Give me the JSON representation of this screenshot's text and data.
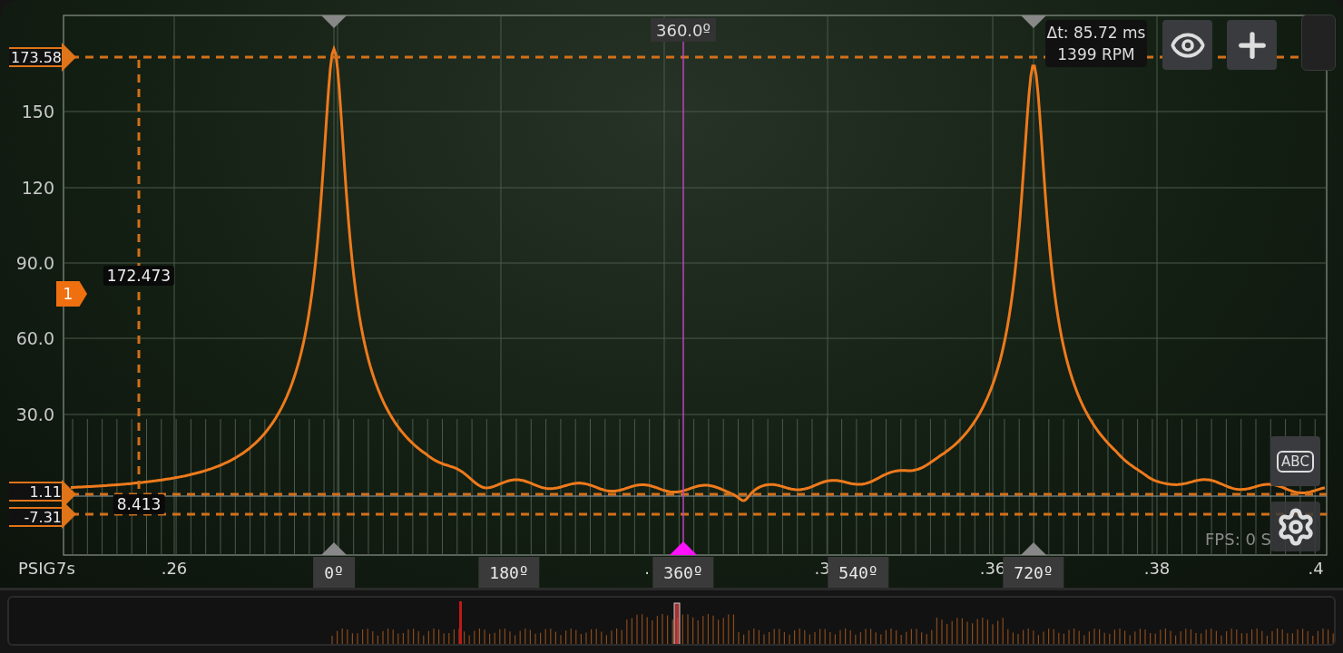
{
  "y_axis": {
    "unit": "PSIG",
    "ticks": [
      "150",
      "120",
      "90.0",
      "60.0",
      "30.0"
    ]
  },
  "x_axis": {
    "unit": "7s",
    "ticks": [
      ".26",
      ".",
      ".3",
      ".36",
      ".38",
      ".4"
    ]
  },
  "angle_markers": [
    {
      "label": "0º",
      "kind": "reference"
    },
    {
      "label": "180º",
      "kind": "plain"
    },
    {
      "label": "360º",
      "kind": "cursor"
    },
    {
      "label": "540º",
      "kind": "plain"
    },
    {
      "label": "720º",
      "kind": "reference"
    }
  ],
  "cursor": {
    "label": "360.0º"
  },
  "level_cursors": [
    {
      "label": "173.58"
    },
    {
      "label": "1.11"
    },
    {
      "label": "-7.31"
    }
  ],
  "readouts": [
    "172.473",
    "8.413"
  ],
  "channel": {
    "label": "1",
    "color": "#f07010"
  },
  "measurement": {
    "delta": "Δt: 85.72 ms",
    "rpm": "1399 RPM"
  },
  "abc_button": "ABC",
  "status": "FPS: 0 S"
}
